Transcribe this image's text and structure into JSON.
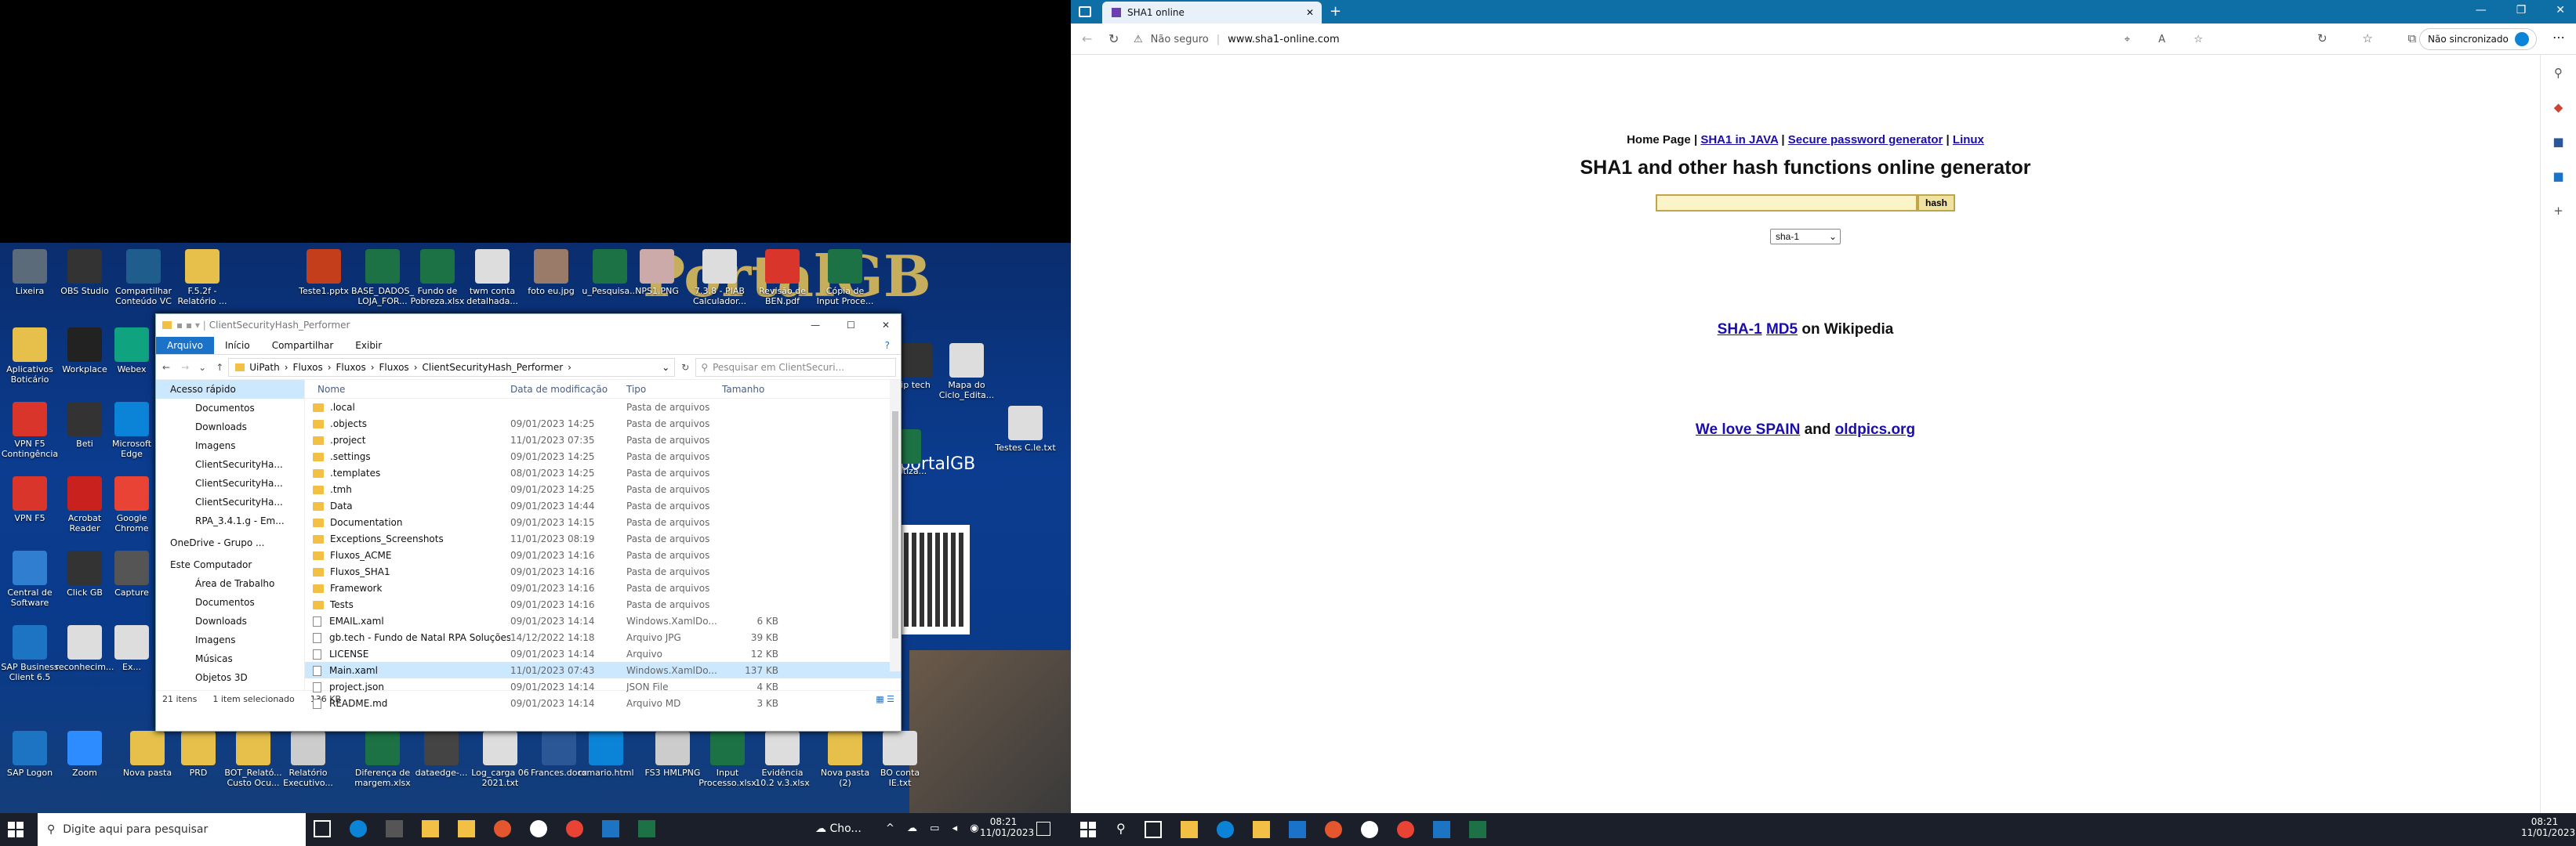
{
  "desktop": {
    "icons": [
      {
        "label": "Lixeira",
        "c": "#5b6b7a"
      },
      {
        "label": "OBS Studio",
        "c": "#333"
      },
      {
        "label": "Compartilhar Conteúdo VC",
        "c": "#1f5e8c"
      },
      {
        "label": "F.5.2f - Relatório ...",
        "c": "#e6c04a"
      },
      {
        "label": "Teste1.pptx",
        "c": "#c43e1c"
      },
      {
        "label": "BASE_DADOS_LOJA_FOR...",
        "c": "#1d7245"
      },
      {
        "label": "Fundo de Pobreza.xlsx",
        "c": "#1d7245"
      },
      {
        "label": "twm conta detalhada...",
        "c": "#ddd"
      },
      {
        "label": "foto eu.jpg",
        "c": "#9a7b6a"
      },
      {
        "label": "u_Pesquisa...",
        "c": "#1d7245"
      },
      {
        "label": "NPS1.PNG",
        "c": "#caa"
      },
      {
        "label": "7.3.8 - PIAB Calculador...",
        "c": "#ddd"
      },
      {
        "label": "Revisão de BEN.pdf",
        "c": "#d9352b"
      },
      {
        "label": "Cópia de Input Proce...",
        "c": "#1d7245"
      },
      {
        "label": "Aplicativos Boticário",
        "c": "#e6c04a"
      },
      {
        "label": "Workplace",
        "c": "#222"
      },
      {
        "label": "Webex",
        "c": "#10a37f"
      },
      {
        "label": "VPN F5 Contingência",
        "c": "#d9352b"
      },
      {
        "label": "Beti",
        "c": "#333"
      },
      {
        "label": "Microsoft Edge",
        "c": "#0b84d8"
      },
      {
        "label": "VPN F5",
        "c": "#d9352b"
      },
      {
        "label": "Acrobat Reader",
        "c": "#c9211e"
      },
      {
        "label": "Google Chrome",
        "c": "#e84335"
      },
      {
        "label": "Central de Software",
        "c": "#2f7ed0"
      },
      {
        "label": "Click GB",
        "c": "#333"
      },
      {
        "label": "Capture",
        "c": "#555"
      },
      {
        "label": "SAP Business Client 6.5",
        "c": "#1c74c3"
      },
      {
        "label": "reconhecim...",
        "c": "#ddd"
      },
      {
        "label": "Ex...",
        "c": "#ddd"
      },
      {
        "label": "SAP Logon",
        "c": "#1c74c3"
      },
      {
        "label": "Zoom",
        "c": "#2d8cff"
      },
      {
        "label": "Nova pasta",
        "c": "#e6c04a"
      },
      {
        "label": "PRD",
        "c": "#e6c04a"
      },
      {
        "label": "BOT_Relató... Custo Ocu...",
        "c": "#e6c04a"
      },
      {
        "label": "Relatório Executivo...",
        "c": "#ccc"
      },
      {
        "label": "Diferença de margem.xlsx",
        "c": "#1d7245"
      },
      {
        "label": "dataedge-...",
        "c": "#444"
      },
      {
        "label": "Log_carga 06 2021.txt",
        "c": "#ddd"
      },
      {
        "label": "Frances.docx",
        "c": "#2b5797"
      },
      {
        "label": "romario.html",
        "c": "#0b84d8"
      },
      {
        "label": "FS3 HMLPNG",
        "c": "#ccc"
      },
      {
        "label": "Input Processo.xlsx",
        "c": "#1d7245"
      },
      {
        "label": "Evidência 10.2 v.3.xlsx",
        "c": "#ddd"
      },
      {
        "label": "Nova pasta (2)",
        "c": "#e6c04a"
      },
      {
        "label": "BO conta IE.txt",
        "c": "#ddd"
      },
      {
        "label": "ip tech",
        "c": "#333"
      },
      {
        "label": "Mapa do Ciclo_Edita...",
        "c": "#ddd"
      },
      {
        "label": "Testes C.le.txt",
        "c": "#ddd"
      },
      {
        "label": "...matiza...",
        "c": "#1d7245"
      }
    ],
    "portal_text": "PortalGB",
    "portal_sub": "/portalGB"
  },
  "explorer": {
    "title": "ClientSecurityHash_Performer",
    "tabs": [
      "Arquivo",
      "Início",
      "Compartilhar",
      "Exibir"
    ],
    "path": [
      "UiPath",
      "Fluxos",
      "Fluxos",
      "Fluxos",
      "ClientSecurityHash_Performer"
    ],
    "search_placeholder": "Pesquisar em ClientSecuri...",
    "nav": [
      "Acesso rápido",
      "Documentos",
      "Downloads",
      "Imagens",
      "ClientSecurityHa...",
      "ClientSecurityHa...",
      "ClientSecurityHa...",
      "RPA_3.4.1.g - Em...",
      "OneDrive - Grupo ...",
      "Este Computador",
      "Área de Trabalho",
      "Documentos",
      "Downloads",
      "Imagens",
      "Músicas",
      "Objetos 3D"
    ],
    "cols": [
      "Nome",
      "Data de modificação",
      "Tipo",
      "Tamanho"
    ],
    "rows": [
      {
        "n": ".local",
        "d": "",
        "t": "Pasta de arquivos",
        "s": "",
        "k": "f"
      },
      {
        "n": ".objects",
        "d": "09/01/2023 14:25",
        "t": "Pasta de arquivos",
        "s": "",
        "k": "f"
      },
      {
        "n": ".project",
        "d": "11/01/2023 07:35",
        "t": "Pasta de arquivos",
        "s": "",
        "k": "f"
      },
      {
        "n": ".settings",
        "d": "09/01/2023 14:25",
        "t": "Pasta de arquivos",
        "s": "",
        "k": "f"
      },
      {
        "n": ".templates",
        "d": "08/01/2023 14:25",
        "t": "Pasta de arquivos",
        "s": "",
        "k": "f"
      },
      {
        "n": ".tmh",
        "d": "09/01/2023 14:25",
        "t": "Pasta de arquivos",
        "s": "",
        "k": "f"
      },
      {
        "n": "Data",
        "d": "09/01/2023 14:44",
        "t": "Pasta de arquivos",
        "s": "",
        "k": "f"
      },
      {
        "n": "Documentation",
        "d": "09/01/2023 14:15",
        "t": "Pasta de arquivos",
        "s": "",
        "k": "f"
      },
      {
        "n": "Exceptions_Screenshots",
        "d": "11/01/2023 08:19",
        "t": "Pasta de arquivos",
        "s": "",
        "k": "f"
      },
      {
        "n": "Fluxos_ACME",
        "d": "09/01/2023 14:16",
        "t": "Pasta de arquivos",
        "s": "",
        "k": "f"
      },
      {
        "n": "Fluxos_SHA1",
        "d": "09/01/2023 14:16",
        "t": "Pasta de arquivos",
        "s": "",
        "k": "f"
      },
      {
        "n": "Framework",
        "d": "09/01/2023 14:16",
        "t": "Pasta de arquivos",
        "s": "",
        "k": "f"
      },
      {
        "n": "Tests",
        "d": "09/01/2023 14:16",
        "t": "Pasta de arquivos",
        "s": "",
        "k": "f"
      },
      {
        "n": "EMAIL.xaml",
        "d": "09/01/2023 14:14",
        "t": "Windows.XamlDo...",
        "s": "6 KB",
        "k": "d"
      },
      {
        "n": "gb.tech - Fundo de Natal RPA Soluções C...",
        "d": "14/12/2022 14:18",
        "t": "Arquivo JPG",
        "s": "39 KB",
        "k": "d"
      },
      {
        "n": "LICENSE",
        "d": "09/01/2023 14:14",
        "t": "Arquivo",
        "s": "12 KB",
        "k": "d"
      },
      {
        "n": "Main.xaml",
        "d": "11/01/2023 07:43",
        "t": "Windows.XamlDo...",
        "s": "137 KB",
        "k": "d",
        "sel": true
      },
      {
        "n": "project.json",
        "d": "09/01/2023 14:14",
        "t": "JSON File",
        "s": "4 KB",
        "k": "d"
      },
      {
        "n": "README.md",
        "d": "09/01/2023 14:14",
        "t": "Arquivo MD",
        "s": "3 KB",
        "k": "d"
      }
    ],
    "status": [
      "21 itens",
      "1 item selecionado",
      "136 KB"
    ]
  },
  "taskbar_left": {
    "search": "Digite aqui para pesquisar",
    "weather": "Cho...",
    "time": "08:21",
    "date": "11/01/2023"
  },
  "browser": {
    "tab_title": "SHA1 online",
    "security": "Não seguro",
    "url": "www.sha1-online.com",
    "profile": "Não sincronizado",
    "nav_links": {
      "home": "Home Page",
      "sep": "|",
      "java": "SHA1 in JAVA",
      "gen": "Secure password generator",
      "linux": "Linux"
    },
    "heading": "SHA1 and other hash functions online generator",
    "input_value": "",
    "hash_button": "hash",
    "select_value": "sha-1",
    "wiki": {
      "sha": "SHA-1",
      "md5": "MD5",
      "rest": "on Wikipedia"
    },
    "spain": {
      "a": "We love SPAIN",
      "and": "and",
      "b": "oldpics.org"
    }
  },
  "taskbar_right": {
    "time": "08:21",
    "date": "11/01/2023"
  }
}
